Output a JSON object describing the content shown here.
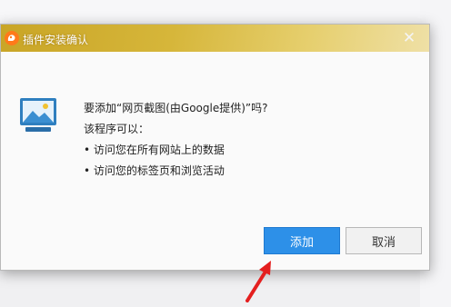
{
  "dialog": {
    "title": "插件安装确认",
    "close_symbol": "✕",
    "message_line1": "要添加“网页截图(由Google提供)”吗?",
    "message_line2": "该程序可以：",
    "permissions": [
      "• 访问您在所有网站上的数据",
      "• 访问您的标签页和浏览活动"
    ],
    "add_label": "添加",
    "cancel_label": "取消"
  },
  "icons": {
    "app": "uc-browser-squirrel-icon",
    "body": "screenshot-image-icon",
    "annotation": "red-arrow-icon"
  },
  "colors": {
    "titlebar": "#d4b033",
    "primary_button": "#2d90e8",
    "annotation_arrow": "#e41f1f"
  }
}
